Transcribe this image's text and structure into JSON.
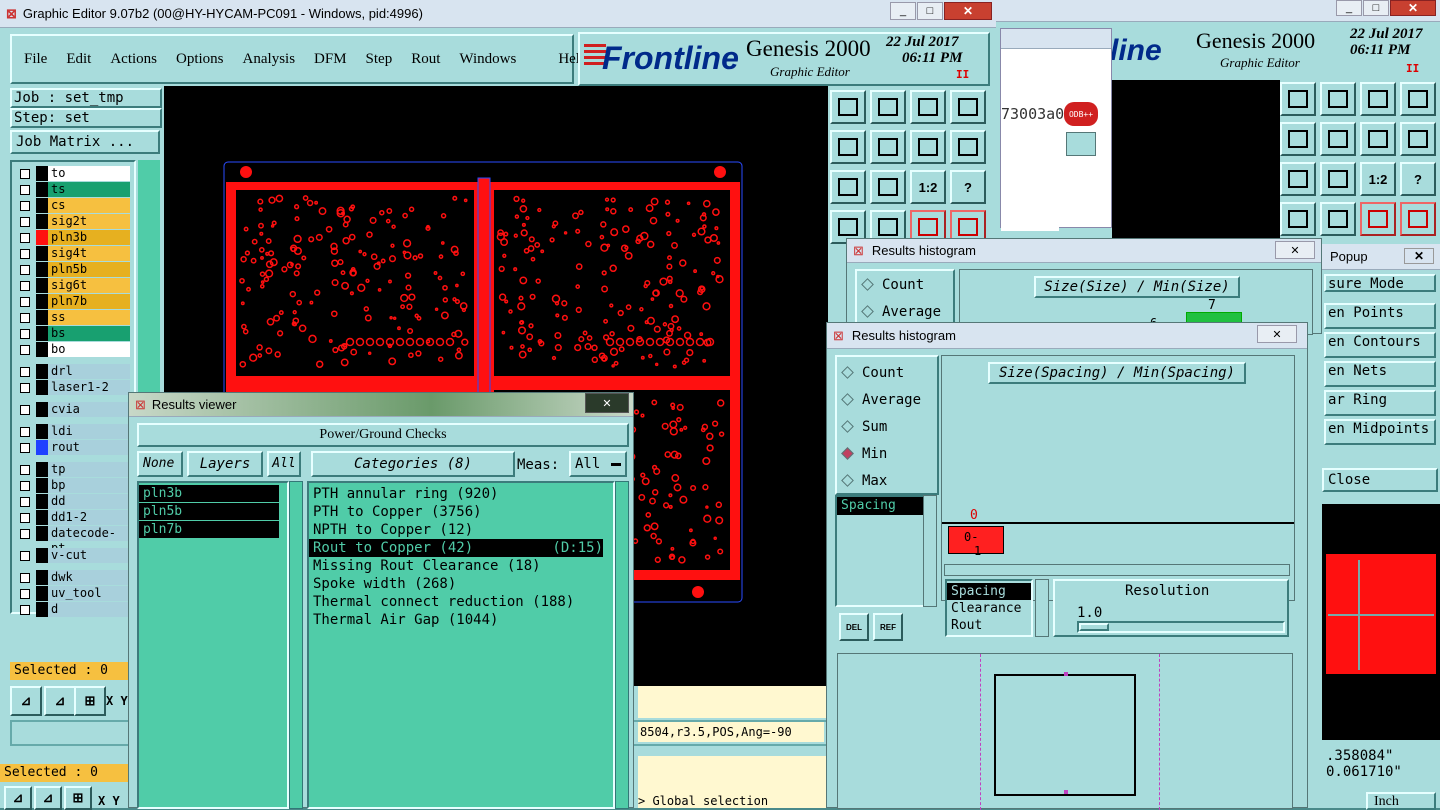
{
  "main_window": {
    "title": "Graphic Editor 9.07b2 (00@HY-HYCAM-PC091 - Windows, pid:4996)",
    "menu": [
      "File",
      "Edit",
      "Actions",
      "Options",
      "Analysis",
      "DFM",
      "Step",
      "Rout",
      "Windows",
      "Help"
    ],
    "brand": "Frontline",
    "product": "Genesis 2000",
    "subtitle": "Graphic Editor",
    "date": "22 Jul 2017",
    "time": "06:11 PM",
    "pause_icon": "II",
    "job_label": "Job : set_tmp",
    "step_label": "Step: set",
    "job_matrix_button": "Job Matrix ...",
    "selected_label": "Selected : 0",
    "coord_status": "8504,r3.5,POS,Ang=-90",
    "global_selection": "> Global selection",
    "xy_label": "X Y"
  },
  "layers": [
    {
      "name": "to",
      "color": "#ffffff"
    },
    {
      "name": "ts",
      "color": "#18a070"
    },
    {
      "name": "cs",
      "color": "#f6c040"
    },
    {
      "name": "sig2t",
      "color": "#f6c040"
    },
    {
      "name": "pln3b",
      "color": "#e6b020"
    },
    {
      "name": "sig4t",
      "color": "#f6c040"
    },
    {
      "name": "pln5b",
      "color": "#e6b020"
    },
    {
      "name": "sig6t",
      "color": "#f6c040"
    },
    {
      "name": "pln7b",
      "color": "#e6b020"
    },
    {
      "name": "ss",
      "color": "#f6c040"
    },
    {
      "name": "bs",
      "color": "#18a070"
    },
    {
      "name": "bo",
      "color": "#ffffff"
    },
    {
      "name": "drl",
      "color": "#a8d0dc"
    },
    {
      "name": "laser1-2",
      "color": "#a8d0dc"
    },
    {
      "name": "cvia",
      "color": "#a8d0dc"
    },
    {
      "name": "ldi",
      "color": "#a8d0dc"
    },
    {
      "name": "rout",
      "color": "#a8d0dc"
    },
    {
      "name": "tp",
      "color": "#a8d0dc"
    },
    {
      "name": "bp",
      "color": "#a8d0dc"
    },
    {
      "name": "dd",
      "color": "#a8d0dc"
    },
    {
      "name": "dd1-2",
      "color": "#a8d0dc"
    },
    {
      "name": "datecode-pt",
      "color": "#a8d0dc"
    },
    {
      "name": "v-cut",
      "color": "#a8d0dc"
    },
    {
      "name": "dwk",
      "color": "#a8d0dc"
    },
    {
      "name": "uv_tool",
      "color": "#a8d0dc"
    },
    {
      "name": "d",
      "color": "#a8d0dc"
    }
  ],
  "results_viewer": {
    "title": "Results viewer",
    "header": "Power/Ground Checks",
    "none_btn": "None",
    "layers_btn": "Layers",
    "all_btn": "All",
    "categories_btn": "Categories (8)",
    "meas_label": "Meas:",
    "meas_value": "All",
    "layer_items": [
      "pln3b",
      "pln5b",
      "pln7b"
    ],
    "categories": [
      {
        "label": "PTH annular ring (920)",
        "extra": ""
      },
      {
        "label": "PTH to Copper (3756)",
        "extra": ""
      },
      {
        "label": "NPTH to Copper (12)",
        "extra": ""
      },
      {
        "label": "Rout to Copper (42)",
        "extra": "(D:15)"
      },
      {
        "label": "Missing Rout Clearance (18)",
        "extra": ""
      },
      {
        "label": "Spoke width (268)",
        "extra": ""
      },
      {
        "label": "Thermal connect reduction (188)",
        "extra": ""
      },
      {
        "label": "Thermal Air Gap (1044)",
        "extra": ""
      }
    ]
  },
  "histogram_back": {
    "title": "Results histogram",
    "options": [
      "Count",
      "Average"
    ],
    "header": "Size(Size) / Min(Size)",
    "bar_value": "7",
    "side_value": "6"
  },
  "histogram_front": {
    "title": "Results histogram",
    "options": [
      "Count",
      "Average",
      "Sum",
      "Min",
      "Max"
    ],
    "header": "Size(Spacing) / Min(Spacing)",
    "list_item": "Spacing",
    "bar_top": "0",
    "bar_label": "0-",
    "bar_label2": "1",
    "measures": [
      "Spacing",
      "Clearance",
      "Rout"
    ],
    "resolution_label": "Resolution",
    "resolution_value": "1.0",
    "del_btn": "DEL",
    "ref_btn": "REF"
  },
  "back_window": {
    "product": "Genesis 2000",
    "subtitle": "Graphic Editor",
    "date": "22 Jul 2017",
    "time": "06:11 PM",
    "code": "73003a0",
    "popup_title": "Popup",
    "popup_items": [
      "sure Mode",
      "en Points",
      "en Contours",
      "en Nets",
      "ar Ring",
      "en Midpoints"
    ],
    "close_label": "Close",
    "coord1": ".358084\"",
    "coord2": "0.061710\"",
    "unit": "Inch"
  },
  "colors": {
    "teal": "#a8dcdc",
    "green": "#50cca8",
    "copper": "#ff1010",
    "canvas": "#000000"
  }
}
